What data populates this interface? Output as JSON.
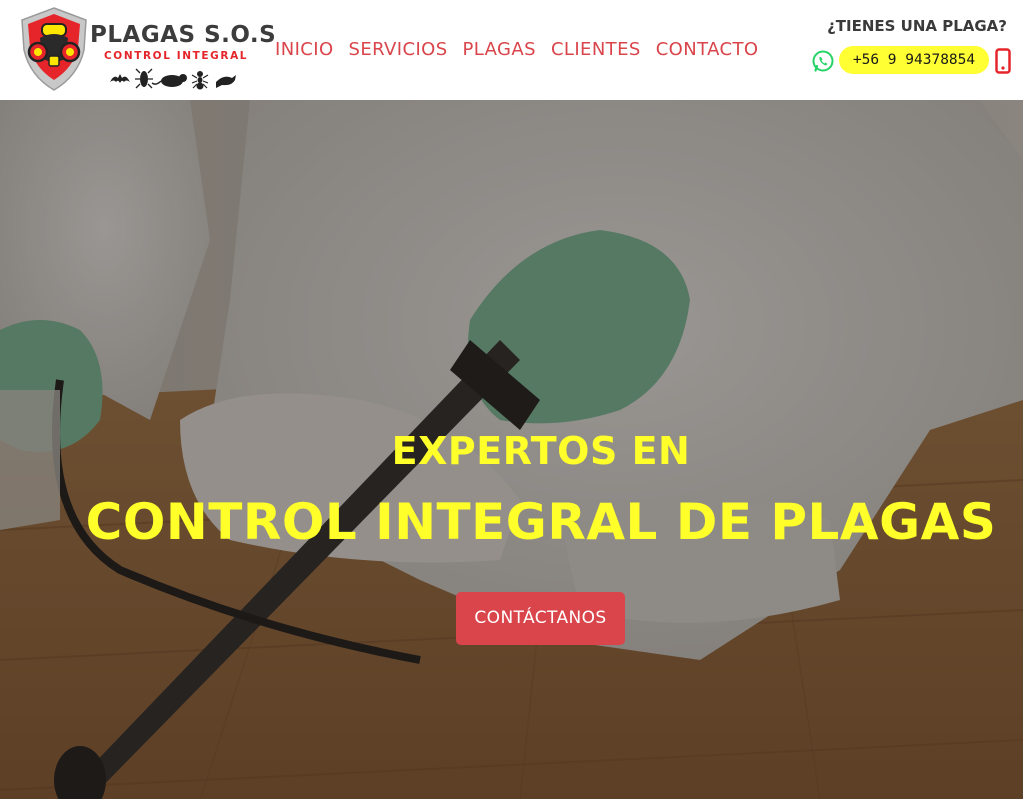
{
  "brand": {
    "name": "PLAGAS S.O.S",
    "tagline": "CONTROL INTEGRAL",
    "pest_icons": [
      "bat-icon",
      "cockroach-icon",
      "rat-icon",
      "ant-icon",
      "pigeon-icon"
    ]
  },
  "nav": {
    "items": [
      {
        "label": "INICIO"
      },
      {
        "label": "SERVICIOS"
      },
      {
        "label": "PLAGAS"
      },
      {
        "label": "CLIENTES"
      },
      {
        "label": "CONTACTO"
      }
    ]
  },
  "contact": {
    "question": "¿TIENES UNA PLAGA?",
    "phone": "+56 9 94378854",
    "icons": [
      "whatsapp-icon",
      "mobile-phone-icon"
    ]
  },
  "hero": {
    "kicker": "EXPERTOS EN",
    "title": "CONTROL INTEGRAL DE PLAGAS",
    "cta_label": "CONTÁCTANOS"
  },
  "colors": {
    "accent_red": "#d9454b",
    "highlight_yellow": "#ffff2a",
    "whatsapp_green": "#25d366",
    "logo_red": "#e5252a"
  }
}
